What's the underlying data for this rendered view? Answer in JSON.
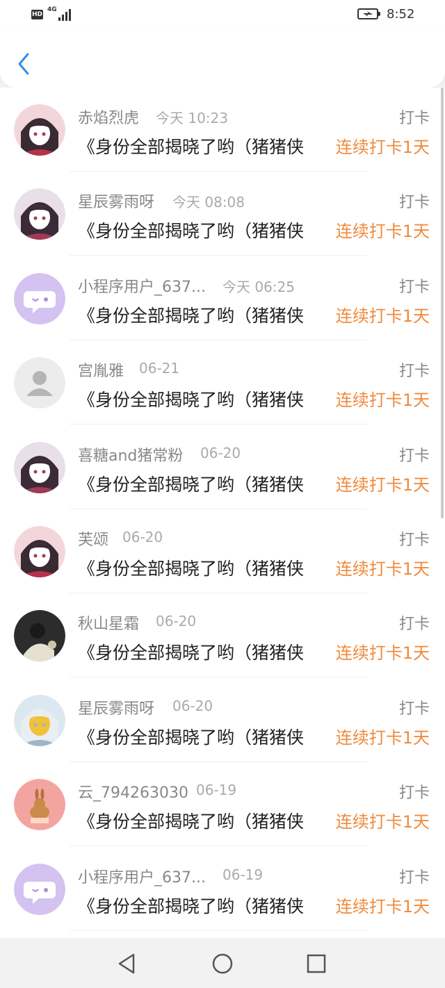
{
  "status_bar": {
    "hd": "HD",
    "network": "4G",
    "time": "8:52"
  },
  "header": {
    "back_icon": "chevron-left-icon"
  },
  "colors": {
    "accent_blue": "#2f8fe8",
    "streak_orange": "#f08a3c",
    "text_gray": "#888888",
    "text_dark": "#222222"
  },
  "records": [
    {
      "name": "赤焰烈虎",
      "date": "今天 10:23",
      "tag": "打卡",
      "content": "《身份全部揭晓了哟（猪猪侠",
      "streak": "连续打卡1天",
      "avatar": "anime-avatar"
    },
    {
      "name": "星辰雾雨呀",
      "date": "今天 08:08",
      "tag": "打卡",
      "content": "《身份全部揭晓了哟（猪猪侠",
      "streak": "连续打卡1天",
      "avatar": "anime-avatar"
    },
    {
      "name": "小程序用户_637...",
      "date": "今天 06:25",
      "tag": "打卡",
      "content": "《身份全部揭晓了哟（猪猪侠",
      "streak": "连续打卡1天",
      "avatar": "chat-bubble-avatar"
    },
    {
      "name": "宫胤雅",
      "date": "06-21",
      "tag": "打卡",
      "content": "《身份全部揭晓了哟（猪猪侠",
      "streak": "连续打卡1天",
      "avatar": "default-person-avatar"
    },
    {
      "name": "喜糖and猪常粉",
      "date": "06-20",
      "tag": "打卡",
      "content": "《身份全部揭晓了哟（猪猪侠",
      "streak": "连续打卡1天",
      "avatar": "anime-avatar"
    },
    {
      "name": "芙颂",
      "date": "06-20",
      "tag": "打卡",
      "content": "《身份全部揭晓了哟（猪猪侠",
      "streak": "连续打卡1天",
      "avatar": "anime-avatar"
    },
    {
      "name": "秋山星霜",
      "date": "06-20",
      "tag": "打卡",
      "content": "《身份全部揭晓了哟（猪猪侠",
      "streak": "连续打卡1天",
      "avatar": "photo-avatar"
    },
    {
      "name": "星辰雾雨呀",
      "date": "06-20",
      "tag": "打卡",
      "content": "《身份全部揭晓了哟（猪猪侠",
      "streak": "连续打卡1天",
      "avatar": "anime-avatar"
    },
    {
      "name": "云_794263030",
      "date": "06-19",
      "tag": "打卡",
      "content": "《身份全部揭晓了哟（猪猪侠",
      "streak": "连续打卡1天",
      "avatar": "rabbit-avatar"
    },
    {
      "name": "小程序用户_637...",
      "date": "06-19",
      "tag": "打卡",
      "content": "《身份全部揭晓了哟（猪猪侠",
      "streak": "连续打卡1天",
      "avatar": "chat-bubble-avatar"
    }
  ],
  "nav_bar": {
    "back": "triangle-back-icon",
    "home": "circle-home-icon",
    "recents": "square-recents-icon"
  }
}
